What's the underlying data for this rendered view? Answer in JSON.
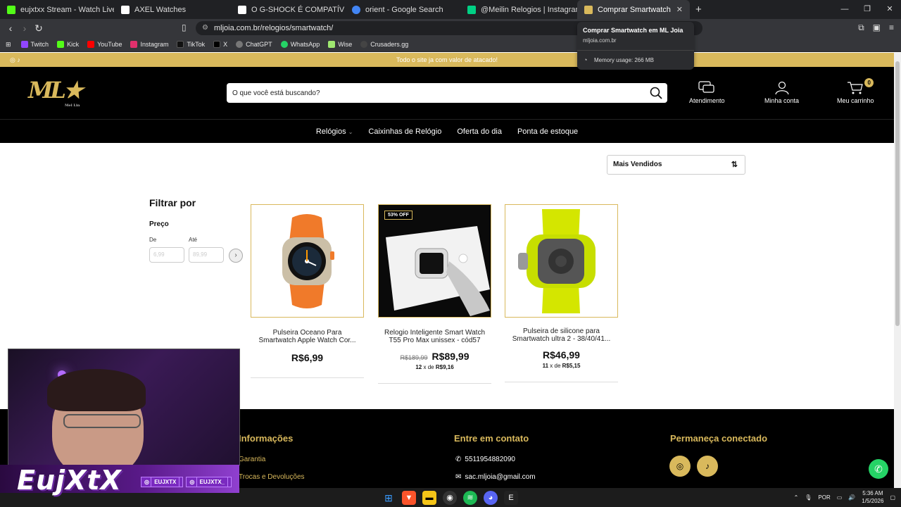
{
  "browser": {
    "tabs": [
      {
        "label": "eujxtxx Stream - Watch Live on Kick",
        "fav_color": "#53fc18"
      },
      {
        "label": "AXEL Watches",
        "fav_color": "#111111"
      },
      {
        "label": "O G-SHOCK É COMPATÍVEL COM O S",
        "fav_color": "#ffffff"
      },
      {
        "label": "orient - Google Search",
        "fav_color": "#4285f4"
      },
      {
        "label": "@Meilin Relogios | Instagram, TikTok",
        "fav_color": "#00d084"
      },
      {
        "label": "Comprar Smartwatch em ML Joia",
        "fav_color": "#d9b95c"
      }
    ],
    "url": "mljoia.com.br/relogios/smartwatch/",
    "bookmarks": [
      {
        "label": "Twitch",
        "color": "#9146ff"
      },
      {
        "label": "Kick",
        "color": "#53fc18"
      },
      {
        "label": "YouTube",
        "color": "#ff0000"
      },
      {
        "label": "Instagram",
        "color": "#e1306c"
      },
      {
        "label": "TikTok",
        "color": "#111111"
      },
      {
        "label": "X",
        "color": "#000000"
      },
      {
        "label": "ChatGPT",
        "color": "#777777"
      },
      {
        "label": "WhatsApp",
        "color": "#25d366"
      },
      {
        "label": "Wise",
        "color": "#9fe870"
      },
      {
        "label": "Crusaders.gg",
        "color": "#444444"
      }
    ],
    "tooltip": {
      "title": "Comprar Smartwatch em ML Joia",
      "domain": "mljoia.com.br",
      "memory": "Memory usage: 266 MB"
    }
  },
  "site": {
    "promo": "Todo o site ja com valor de atacado!",
    "search_placeholder": "O que você está buscando?",
    "header_links": {
      "support": "Atendimento",
      "account": "Minha conta",
      "cart": "Meu carrinho",
      "cart_count": "0"
    },
    "nav": [
      "Relógios",
      "Caixinhas de Relógio",
      "Oferta do dia",
      "Ponta de estoque"
    ],
    "sort_label": "Mais Vendidos",
    "filter": {
      "title": "Filtrar por",
      "price": "Preço",
      "from_label": "De",
      "to_label": "Até",
      "from_placeholder": "6,99",
      "to_placeholder": "89,99"
    },
    "products": [
      {
        "name": "Pulseira Oceano Para Smartwatch Apple Watch Cor...",
        "price": "R$6,99",
        "old_price": "",
        "installments": "",
        "badge": ""
      },
      {
        "name": "Relogio Inteligente Smart Watch T55 Pro Max unissex - cód57",
        "price": "R$89,99",
        "old_price": "R$189,99",
        "installments_n": "12",
        "installments_value": "R$9,16",
        "badge": "53% OFF"
      },
      {
        "name": "Pulseira de silicone para Smartwatch ultra 2 - 38/40/41...",
        "price": "R$46,99",
        "old_price": "",
        "installments_n": "11",
        "installments_value": "R$5,15",
        "badge": ""
      }
    ],
    "installment_sep": "x de",
    "footer": {
      "info_title": "Informações",
      "info_links": [
        "Garantia",
        "Trocas e Devoluções"
      ],
      "contact_title": "Entre em contato",
      "phone": "5511954882090",
      "email": "sac.mljoia@gmail.com",
      "social_title": "Permaneça conectado"
    }
  },
  "stream": {
    "name": "EujXtX",
    "tags": [
      "EUJXTX",
      "EUJXTX_"
    ]
  },
  "taskbar": {
    "lang": "POR",
    "time": "5:36 AM",
    "date": "1/5/2026"
  },
  "colors": {
    "gold": "#d9b95c",
    "black": "#000000"
  }
}
